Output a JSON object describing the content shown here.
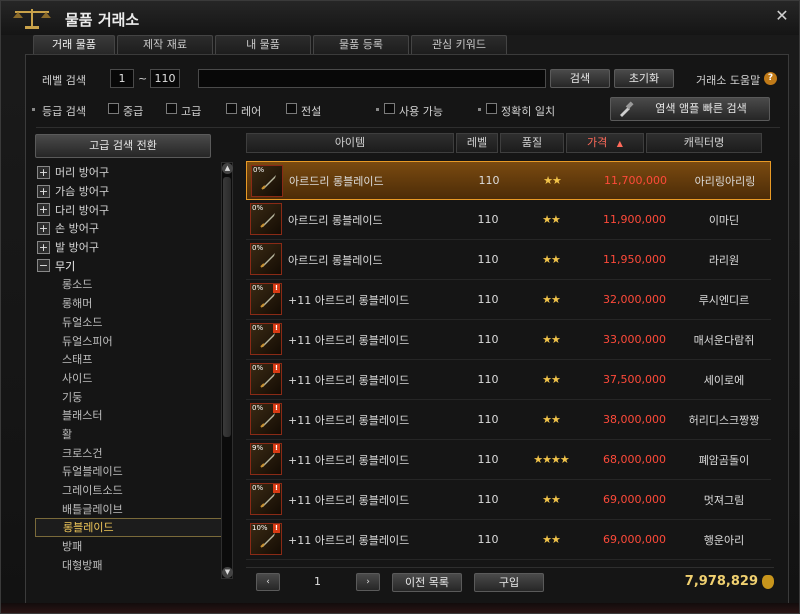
{
  "window": {
    "title": "물품 거래소",
    "close": "✕"
  },
  "tabs": [
    "거래 물품",
    "제작 재료",
    "내 물품",
    "물품 등록",
    "관심 키워드"
  ],
  "search": {
    "level_label": "레벨 검색",
    "level_min": "1",
    "tilde": "~",
    "level_max": "110",
    "keyword": "",
    "search_button": "검색",
    "reset_button": "초기화",
    "help_label": "거래소 도움말",
    "help_icon": "?",
    "grade_label": "등급 검색",
    "grades": [
      "중급",
      "고급",
      "레어",
      "전설"
    ],
    "usable_label": "사용 가능",
    "exact_label": "정확히 일치",
    "dye_button": "염색 앰플 빠른 검색",
    "advanced_button": "고급 검색 전환"
  },
  "tree": [
    {
      "label": "머리 방어구",
      "type": "group",
      "sign": "+"
    },
    {
      "label": "가슴 방어구",
      "type": "group",
      "sign": "+"
    },
    {
      "label": "다리 방어구",
      "type": "group",
      "sign": "+"
    },
    {
      "label": "손 방어구",
      "type": "group",
      "sign": "+"
    },
    {
      "label": "발 방어구",
      "type": "group",
      "sign": "+"
    },
    {
      "label": "무기",
      "type": "open",
      "sign": "−"
    },
    {
      "label": "롱소드",
      "type": "sub"
    },
    {
      "label": "롱해머",
      "type": "sub"
    },
    {
      "label": "듀얼소드",
      "type": "sub"
    },
    {
      "label": "듀얼스피어",
      "type": "sub"
    },
    {
      "label": "스태프",
      "type": "sub"
    },
    {
      "label": "사이드",
      "type": "sub"
    },
    {
      "label": "기둥",
      "type": "sub"
    },
    {
      "label": "블래스터",
      "type": "sub"
    },
    {
      "label": "활",
      "type": "sub"
    },
    {
      "label": "크로스건",
      "type": "sub"
    },
    {
      "label": "듀얼블레이드",
      "type": "sub"
    },
    {
      "label": "그레이트소드",
      "type": "sub"
    },
    {
      "label": "배틀글레이브",
      "type": "sub"
    },
    {
      "label": "롱블레이드",
      "type": "selected"
    },
    {
      "label": "방패",
      "type": "sub"
    },
    {
      "label": "대형방패",
      "type": "sub"
    }
  ],
  "table": {
    "headers": [
      "아이템",
      "레벨",
      "품질",
      "가격",
      "캐릭터명"
    ],
    "sort_indicator": "▲",
    "rows": [
      {
        "pct": "0%",
        "warn": false,
        "name": "아르드리 롱블레이드",
        "level": "110",
        "grade": "★★",
        "price": "11,700,000",
        "seller": "아리링아리링",
        "selected": true
      },
      {
        "pct": "0%",
        "warn": false,
        "name": "아르드리 롱블레이드",
        "level": "110",
        "grade": "★★",
        "price": "11,900,000",
        "seller": "이마딘",
        "selected": false
      },
      {
        "pct": "0%",
        "warn": false,
        "name": "아르드리 롱블레이드",
        "level": "110",
        "grade": "★★",
        "price": "11,950,000",
        "seller": "라리원",
        "selected": false
      },
      {
        "pct": "0%",
        "warn": true,
        "name": "+11 아르드리 롱블레이드",
        "level": "110",
        "grade": "★★",
        "price": "32,000,000",
        "seller": "루시엔디르",
        "selected": false
      },
      {
        "pct": "0%",
        "warn": true,
        "name": "+11 아르드리 롱블레이드",
        "level": "110",
        "grade": "★★",
        "price": "33,000,000",
        "seller": "매서운다람쥐",
        "selected": false
      },
      {
        "pct": "0%",
        "warn": true,
        "name": "+11 아르드리 롱블레이드",
        "level": "110",
        "grade": "★★",
        "price": "37,500,000",
        "seller": "세이로에",
        "selected": false
      },
      {
        "pct": "0%",
        "warn": true,
        "name": "+11 아르드리 롱블레이드",
        "level": "110",
        "grade": "★★",
        "price": "38,000,000",
        "seller": "허리디스크짱짱",
        "selected": false
      },
      {
        "pct": "9%",
        "warn": true,
        "name": "+11 아르드리 롱블레이드",
        "level": "110",
        "grade": "★★★★",
        "price": "68,000,000",
        "seller": "폐암곰돌이",
        "selected": false
      },
      {
        "pct": "0%",
        "warn": true,
        "name": "+11 아르드리 롱블레이드",
        "level": "110",
        "grade": "★★",
        "price": "69,000,000",
        "seller": "멋져그림",
        "selected": false
      },
      {
        "pct": "10%",
        "warn": true,
        "name": "+11 아르드리 롱블레이드",
        "level": "110",
        "grade": "★★",
        "price": "69,000,000",
        "seller": "행운아리",
        "selected": false
      }
    ]
  },
  "footer": {
    "prev": "‹",
    "page": "1",
    "next": "›",
    "prev_list": "이전 목록",
    "buy": "구입",
    "money": "7,978,829"
  },
  "colors": {
    "accent": "#e89a26",
    "price": "#ff4a3a",
    "stars": "#f2c44a",
    "money": "#f0d070"
  }
}
